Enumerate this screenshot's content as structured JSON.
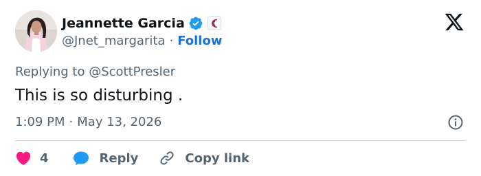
{
  "author": {
    "name": "Jeannette Garcia",
    "handle": "@Jnet_margarita",
    "separator": "·",
    "follow_label": "Follow"
  },
  "tweet": {
    "replying_prefix": "Replying to",
    "replying_to": "@ScottPresler",
    "text": "This is so disturbing .",
    "time": "1:09 PM",
    "meta_separator": "·",
    "date": "May 13, 2026"
  },
  "actions": {
    "like_count": "4",
    "reply_label": "Reply",
    "copy_label": "Copy link"
  },
  "icons": {
    "verified": "verified-badge-icon",
    "affiliate": "affiliate-badge-icon",
    "x_logo": "x-logo-icon",
    "info": "info-icon",
    "heart": "heart-icon",
    "reply": "reply-bubble-icon",
    "link": "link-icon"
  },
  "colors": {
    "text": "#0f1419",
    "secondary": "#536471",
    "link": "#1d72d8",
    "verified": "#1d9bf0",
    "heart": "#f91880",
    "divider": "#cfd9de"
  }
}
